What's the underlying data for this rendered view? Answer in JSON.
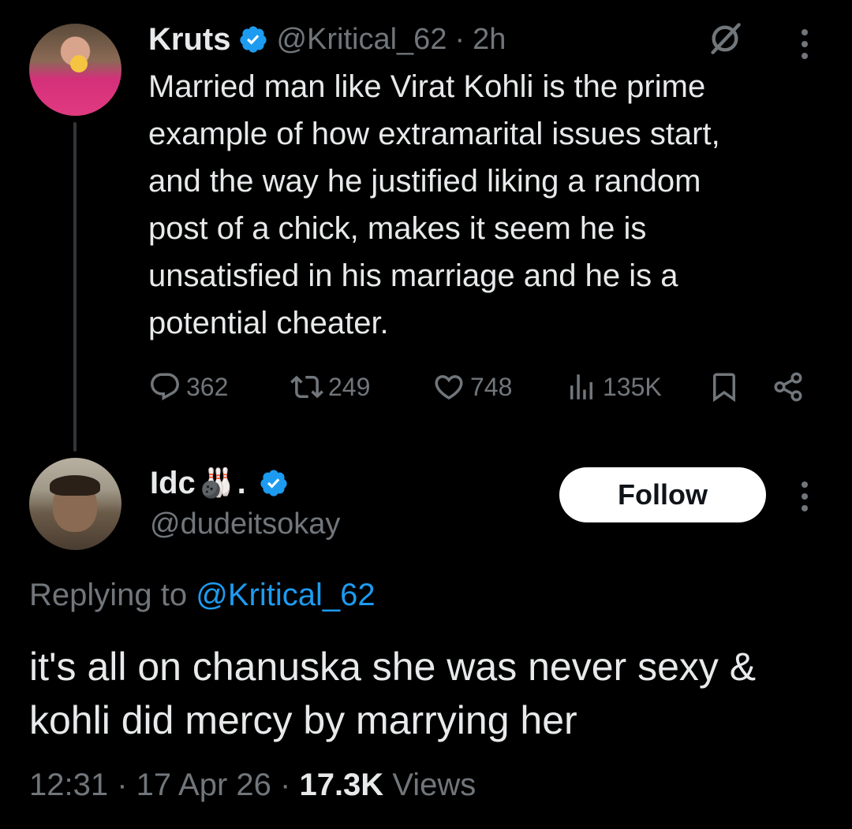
{
  "parent_tweet": {
    "display_name": "Kruts",
    "handle": "@Kritical_62",
    "separator": "·",
    "time_ago": "2h",
    "text": "Married man like Virat Kohli is the prime\nexample of how extramarital issues start,\nand the way he justified liking a random\npost of a chick, makes it seem he is\nunsatisfied in his marriage and he is a\npotential cheater.",
    "actions": {
      "replies": "362",
      "reposts": "249",
      "likes": "748",
      "views": "135K"
    }
  },
  "reply_tweet": {
    "display_name": "Idc",
    "name_suffix": ".",
    "name_emoji": "🎳",
    "handle": "@dudeitsokay",
    "follow_label": "Follow",
    "replying_to_prefix": "Replying to ",
    "replying_to_handle": "@Kritical_62",
    "text": "it's all on chanuska she was never sexy &\nkohli did mercy by marrying her",
    "time": "12:31",
    "date": "17 Apr 26",
    "views_count": "17.3K",
    "views_label": " Views",
    "separator": " · "
  },
  "colors": {
    "background": "#000000",
    "text_primary": "#e7e9ea",
    "text_secondary": "#71767b",
    "accent": "#1d9bf0",
    "verified": "#1d9bf0"
  },
  "icons": [
    "verified-badge-icon",
    "grok-slash-icon",
    "more-options-icon",
    "reply-icon",
    "repost-icon",
    "like-icon",
    "views-icon",
    "bookmark-icon",
    "share-icon"
  ]
}
